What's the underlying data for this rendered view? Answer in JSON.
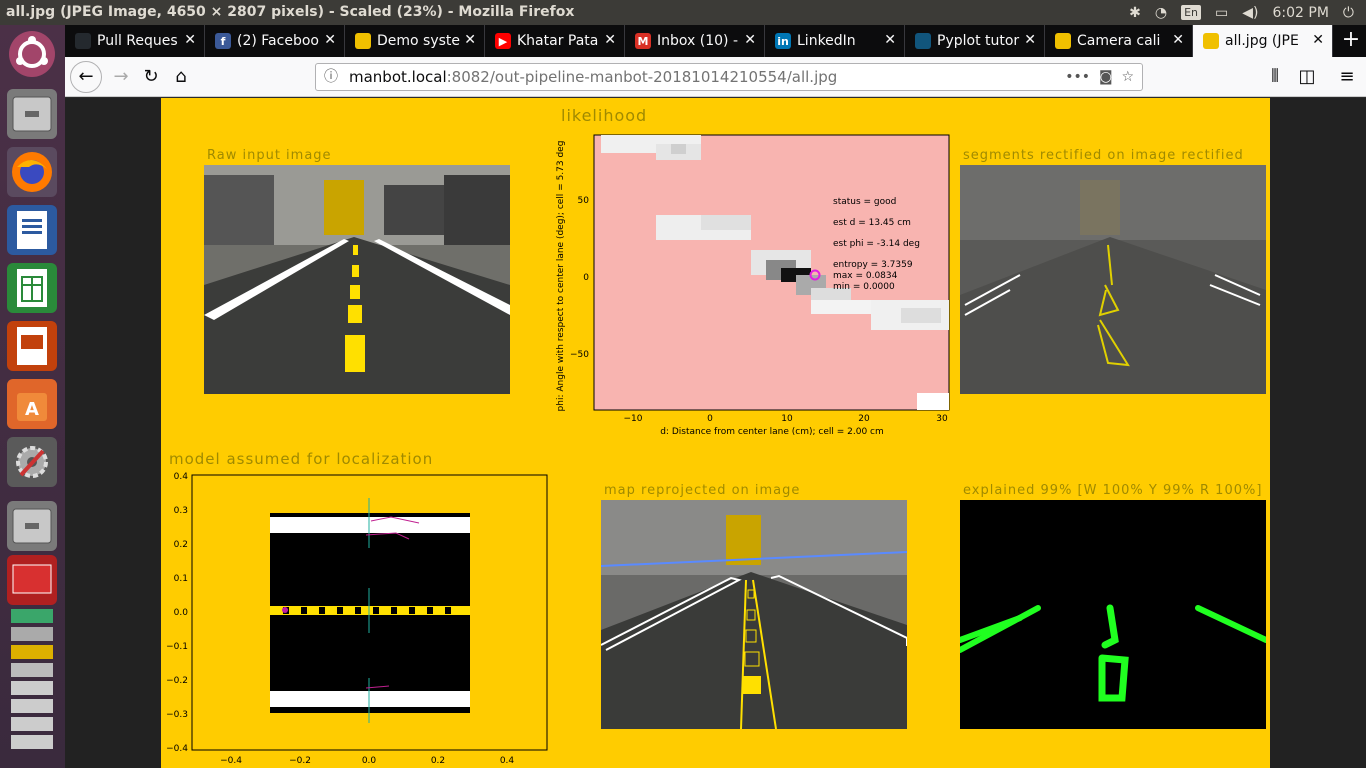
{
  "window_title": "all.jpg (JPEG Image, 4650 × 2807 pixels) - Scaled (23%) - Mozilla Firefox",
  "tray": {
    "lang": "En",
    "clock": "6:02 PM"
  },
  "tabs": [
    {
      "label": "Pull Reques",
      "icon": "github-icon",
      "color": "#24292e",
      "glyph": ""
    },
    {
      "label": "(2) Faceboo",
      "icon": "facebook-icon",
      "color": "#3b5998",
      "glyph": "f"
    },
    {
      "label": "Demo syste",
      "icon": "duckietown-icon",
      "color": "#f0c000",
      "glyph": ""
    },
    {
      "label": "Khatar Pata",
      "icon": "youtube-icon",
      "color": "#ff0000",
      "glyph": "▶"
    },
    {
      "label": "Inbox (10) -",
      "icon": "gmail-icon",
      "color": "#d93025",
      "glyph": "M"
    },
    {
      "label": "LinkedIn",
      "icon": "linkedin-icon",
      "color": "#0077b5",
      "glyph": "in"
    },
    {
      "label": "Pyplot tutor",
      "icon": "matplotlib-icon",
      "color": "#11557c",
      "glyph": ""
    },
    {
      "label": "Camera cali",
      "icon": "duckietown-icon",
      "color": "#f0c000",
      "glyph": ""
    },
    {
      "label": "all.jpg (JPE",
      "icon": "image-icon",
      "color": "#f0c000",
      "glyph": ""
    }
  ],
  "url": {
    "host": "manbot.local",
    "rest": ":8082/out-pipeline-manbot-20181014210554/all.jpg"
  },
  "panels": {
    "raw": "Raw input image",
    "likelihood": "likelihood",
    "segments": "segments rectified on image rectified",
    "model": "model assumed for localization",
    "map": "map reprojected on image",
    "explained": "explained 99% [W 100% Y 99% R 100%]"
  },
  "likelihood_plot": {
    "xlabel": "d: Distance from center lane (cm); cell = 2.00 cm",
    "ylabel": "phi: Angle with respect to center lane (deg); cell = 5.73 deg",
    "xticks": [
      "−10",
      "0",
      "10",
      "20",
      "30"
    ],
    "yticks": [
      "50",
      "0",
      "−50"
    ],
    "annotations": {
      "status": "status = good",
      "est_d": "est d = 13.45 cm",
      "est_phi": "est phi = -3.14 deg",
      "entropy": "entropy = 3.7359",
      "max": "max = 0.0834",
      "min": "min = 0.0000"
    }
  },
  "model_plot": {
    "xticks": [
      "−0.4",
      "−0.2",
      "0.0",
      "0.2",
      "0.4"
    ],
    "yticks": [
      "0.4",
      "0.3",
      "0.2",
      "0.1",
      "0.0",
      "−0.1",
      "−0.2",
      "−0.3",
      "−0.4"
    ]
  },
  "colors": {
    "canvas": "#ffcc00",
    "panel_title": "#a08a00",
    "likelihood_bg": "#f8b4b0"
  }
}
